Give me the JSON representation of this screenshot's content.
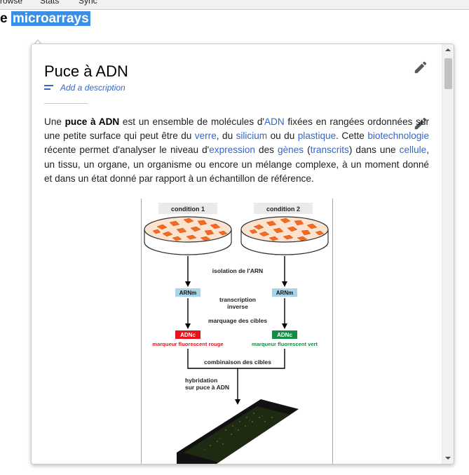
{
  "topbar": {
    "items": [
      "rowse",
      "Stats",
      "Sync"
    ]
  },
  "heading": {
    "prefix": "e",
    "highlight": "microarrays"
  },
  "popup": {
    "title": "Puce à ADN",
    "add_description": "Add a description",
    "paragraph": {
      "t0": "Une ",
      "t1": "puce à ADN",
      "t2": " est un ensemble de molécules d'",
      "l_adn": "ADN",
      "t3": " fixées en rangées ordonnées sur une petite surface qui peut être du ",
      "l_verre": "verre",
      "t4": ", du ",
      "l_silicium": "silicium",
      "t5": " ou du ",
      "l_plastique": "plastique",
      "t6": ". Cette ",
      "l_biotech": "biotechnologie",
      "t7": " récente permet d'analyser le niveau d'",
      "l_expression": "expression",
      "t8": " des ",
      "l_genes": "gènes",
      "t9": " (",
      "l_transcrits": "transcrits",
      "t10": ") dans une ",
      "l_cellule": "cellule",
      "t11": ", un tissu, un organe, un organisme ou encore un mélange complexe, à un moment donné et dans un état donné par rapport à un échantillon de référence."
    },
    "figure": {
      "condition1": "condition 1",
      "condition2": "condition 2",
      "isolation": "isolation de l'ARN",
      "arnm": "ARNm",
      "transcription1": "transcription",
      "transcription2": "inverse",
      "marquage": "marquage des cibles",
      "adnc": "ADNc",
      "marqueur_rouge": "marqueur fluorescent rouge",
      "marqueur_vert": "marqueur fluorescent vert",
      "combinaison": "combinaison des cibles",
      "hybridation1": "hybridation",
      "hybridation2": "sur puce à ADN"
    }
  },
  "colors": {
    "link": "#3366cc",
    "highlight": "#3a8ee6",
    "red_label": "#e8141b",
    "green_label": "#118d44",
    "arnm_bg": "#a5d5e6"
  }
}
